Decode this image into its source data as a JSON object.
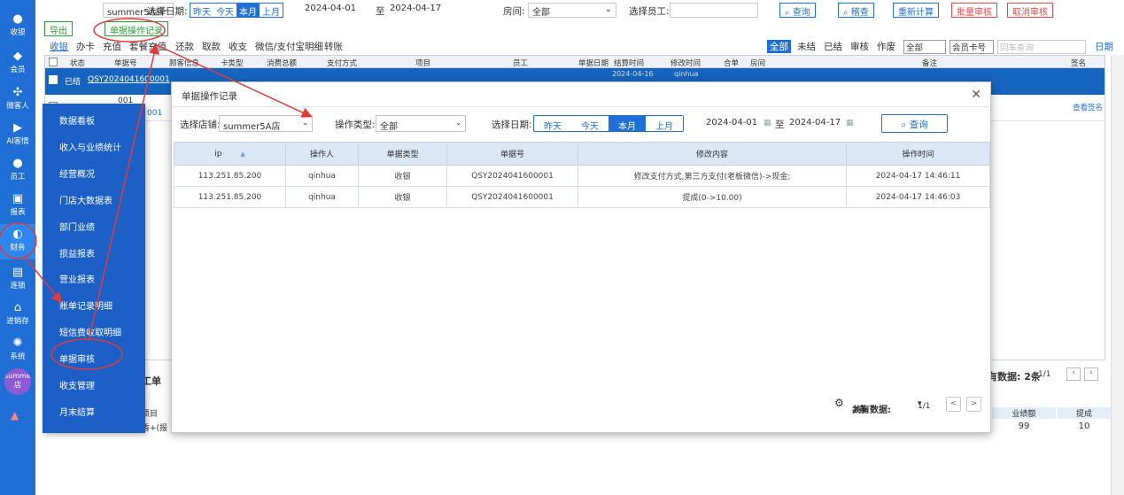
{
  "iconbar": {
    "items": [
      {
        "label": "收银",
        "icon": "cash-icon"
      },
      {
        "label": "会员",
        "icon": "member-icon"
      },
      {
        "label": "微客人",
        "icon": "customer-icon"
      },
      {
        "label": "AI客情",
        "icon": "ai-icon"
      },
      {
        "label": "员工",
        "icon": "staff-icon"
      },
      {
        "label": "报表",
        "icon": "report-icon"
      },
      {
        "label": "财务",
        "icon": "finance-icon"
      },
      {
        "label": "连锁",
        "icon": "chain-icon"
      },
      {
        "label": "进销存",
        "icon": "inventory-icon"
      },
      {
        "label": "系统",
        "icon": "settings-icon"
      }
    ],
    "store_badge": "summer5A店"
  },
  "topbar": {
    "store": "summer5A店",
    "date_label": "选择日期:",
    "date_tabs": [
      "昨天",
      "今天",
      "本月",
      "上月"
    ],
    "date_active": "本月",
    "date_from": "2024-04-01",
    "date_to_sep": "至",
    "date_to": "2024-04-17",
    "room_label": "房间:",
    "room_value": "全部",
    "staff_label": "选择员工:",
    "btn_query": "查询",
    "btn_review": "稽查",
    "btn_recalc": "重新计算",
    "btn_batch_approve": "批量审核",
    "btn_cancel_approve": "取消审核"
  },
  "toolbar": {
    "export": "导出",
    "doc_log": "单据操作记录"
  },
  "tabs": [
    "收银",
    "办卡",
    "充值",
    "套餐充值",
    "还款",
    "取款",
    "收支",
    "微信/支付宝明细",
    "转账"
  ],
  "status_filters": [
    "全部",
    "未结",
    "已结",
    "审核",
    "作废"
  ],
  "filter_select1": "全部",
  "filter_select2": "会员卡号",
  "filter_placeholder": "回车查询",
  "period_link": "日期",
  "grid": {
    "headers": [
      "状态",
      "单据号",
      "顾客信息",
      "卡类型",
      "消费总额",
      "支付方式",
      "项目",
      "员工",
      "单据日期",
      "结算时间",
      "修改时间",
      "合单",
      "房间",
      "备注",
      "签名"
    ],
    "row1_status": "已结",
    "row1_doc": "QSY2024041600001",
    "row1_time": "2024-04-16",
    "row1_user": "qinhua",
    "row2_doc": "001",
    "row2_doc2": "001",
    "row2_action": "查看签名"
  },
  "sidemenu": {
    "items": [
      "数据看板",
      "收入与业绩统计",
      "经营概况",
      "门店大数据表",
      "部门业绩",
      "损益报表",
      "营业报表",
      "账单记录明细",
      "短信费收取明细",
      "单据审核",
      "收支管理",
      "月末结算"
    ]
  },
  "dialog": {
    "title": "单据操作记录",
    "store_label": "选择店铺:",
    "store_value": "summer5A店",
    "optype_label": "操作类型:",
    "optype_value": "全部",
    "date_label": "选择日期:",
    "date_tabs": [
      "昨天",
      "今天",
      "本月",
      "上月"
    ],
    "date_active": "本月",
    "date_from": "2024-04-01",
    "date_sep": "至",
    "date_to": "2024-04-17",
    "search_btn": "查询",
    "columns": [
      "ip",
      "操作人",
      "单据类型",
      "单据号",
      "修改内容",
      "操作时间"
    ],
    "rows": [
      [
        "113.251.85.200",
        "qinhua",
        "收银",
        "QSY2024041600001",
        "修改支付方式,第三方支付(老板微信)->现金;",
        "2024-04-17 14:46:11"
      ],
      [
        "113.251.85.200",
        "qinhua",
        "收银",
        "QSY2024041600001",
        "提成(0->10.00)",
        "2024-04-17 14:46:03"
      ]
    ],
    "footer_total_label": "共有数据:",
    "footer_total_value": "2条",
    "footer_page": "1/1",
    "prev": "<",
    "next": ">"
  },
  "bottom": {
    "panel_title": "工单",
    "total_label": "共有数据:",
    "total_value": "2条",
    "page": "1/1",
    "col_perf": "业绩额",
    "col_commission": "提成",
    "val_perf": "99",
    "val_commission": "10",
    "item_label": "项目",
    "row_text": "香+(报"
  },
  "colors": {
    "primary": "#1f6fd6",
    "sidebar": "#1c5fc6",
    "annotation": "#e03a3a",
    "green": "#2e9b3a"
  }
}
